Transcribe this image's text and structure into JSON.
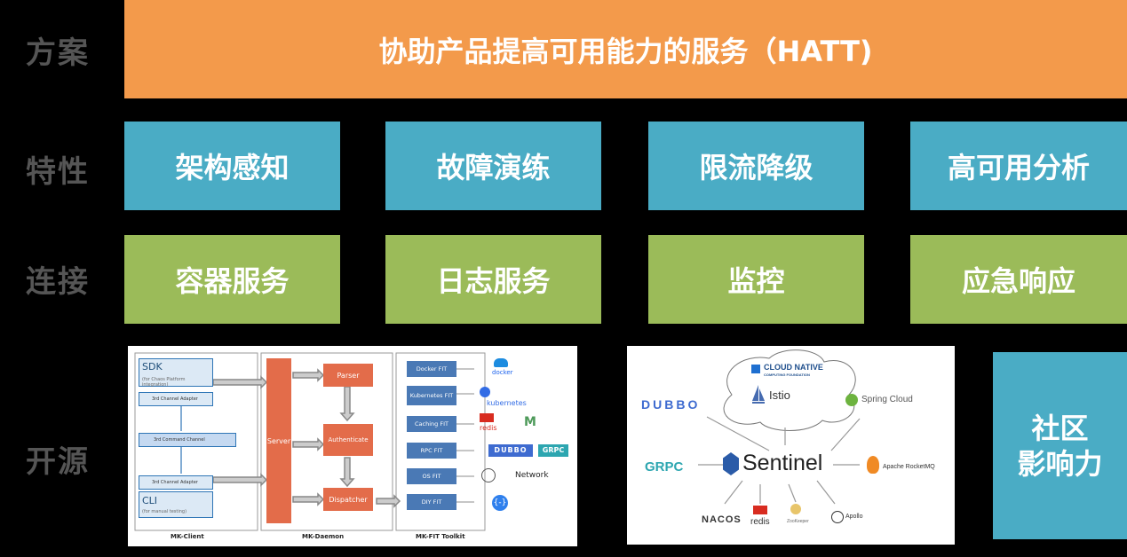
{
  "row_labels": {
    "plan": "方案",
    "features": "特性",
    "connect": "连接",
    "open_source": "开源"
  },
  "banner": "协助产品提高可用能力的服务（HATT)",
  "features": [
    "架构感知",
    "故障演练",
    "限流降级",
    "高可用分析"
  ],
  "connections": [
    "容器服务",
    "日志服务",
    "监控",
    "应急响应"
  ],
  "community": {
    "line1": "社区",
    "line2": "影响力"
  },
  "mk_diagram": {
    "sdk": "SDK",
    "sdk_sub": "(for Chaos Platform integration)",
    "channel_adapter_top": "3rd Channel Adapter",
    "command_channel": "3rd Command Channel",
    "channel_adapter_bottom": "3rd Channel Adapter",
    "cli": "CLI",
    "cli_sub": "(for manual testing)",
    "server": "Server",
    "parser": "Parser",
    "authenticate": "Authenticate",
    "dispatcher": "Dispatcher",
    "fits": [
      "Docker FIT",
      "Kubernetes FIT",
      "Caching FIT",
      "RPC FIT",
      "OS FIT",
      "DIY FIT"
    ],
    "targets": [
      "docker",
      "kubernetes",
      "redis",
      "DUBBO",
      "GRPC",
      "Network"
    ],
    "footer": [
      "MK-Client",
      "MK-Daemon",
      "MK-FIT Toolkit"
    ]
  },
  "eco_diagram": {
    "cncf_line1": "CLOUD NATIVE",
    "cncf_line2": "COMPUTING FOUNDATION",
    "istio": "Istio",
    "spring_cloud": "Spring Cloud",
    "dubbo": "DUBBO",
    "grpc": "GRPC",
    "sentinel": "Sentinel",
    "rocketmq": "Apache RocketMQ",
    "nacos": "NACOS",
    "redis": "redis",
    "zookeeper": "ZooKeeper",
    "apollo": "Apollo"
  },
  "colors": {
    "banner": "#F39A4B",
    "feature": "#4AACC5",
    "connect": "#9BBB59",
    "label": "#555555",
    "background": "#000000"
  }
}
